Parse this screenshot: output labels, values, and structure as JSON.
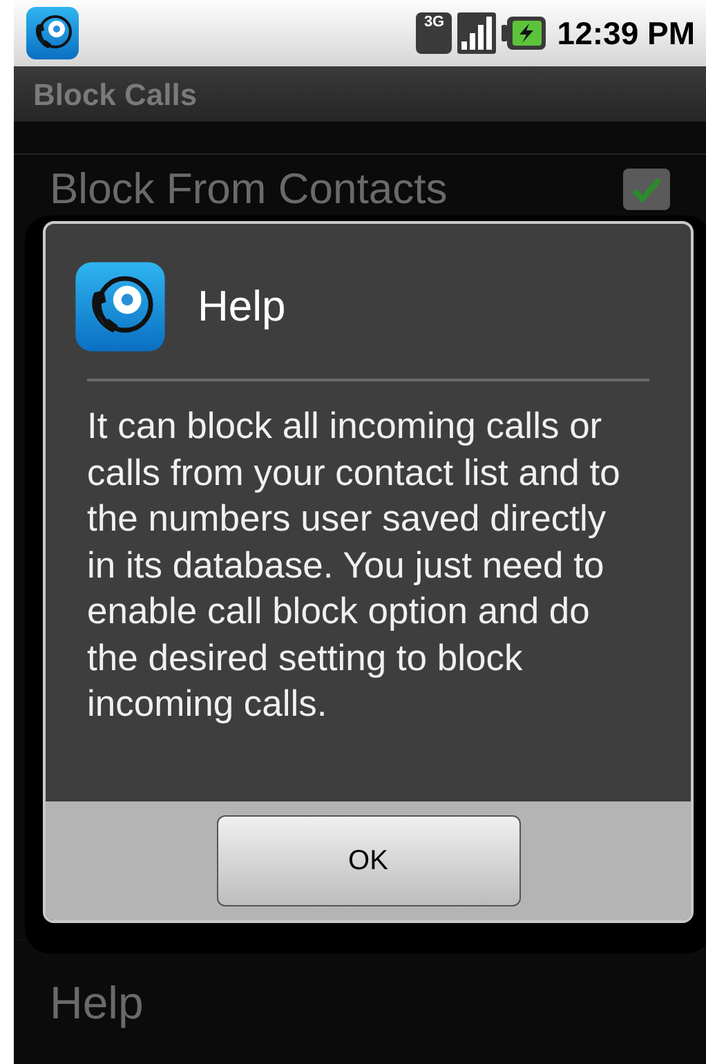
{
  "status_bar": {
    "network_type": "3G",
    "time": "12:39 PM"
  },
  "title_bar": {
    "title": "Block Calls"
  },
  "settings": [
    {
      "label": "Block From Contacts",
      "checked": true
    }
  ],
  "dialog": {
    "title": "Help",
    "message": "It can block all incoming calls or calls from your contact list and to the numbers user saved directly in its database. You just need to enable call block option and do the desired setting to block incoming calls.",
    "buttons": [
      "OK"
    ]
  },
  "bottom_item": {
    "label": "Help"
  }
}
